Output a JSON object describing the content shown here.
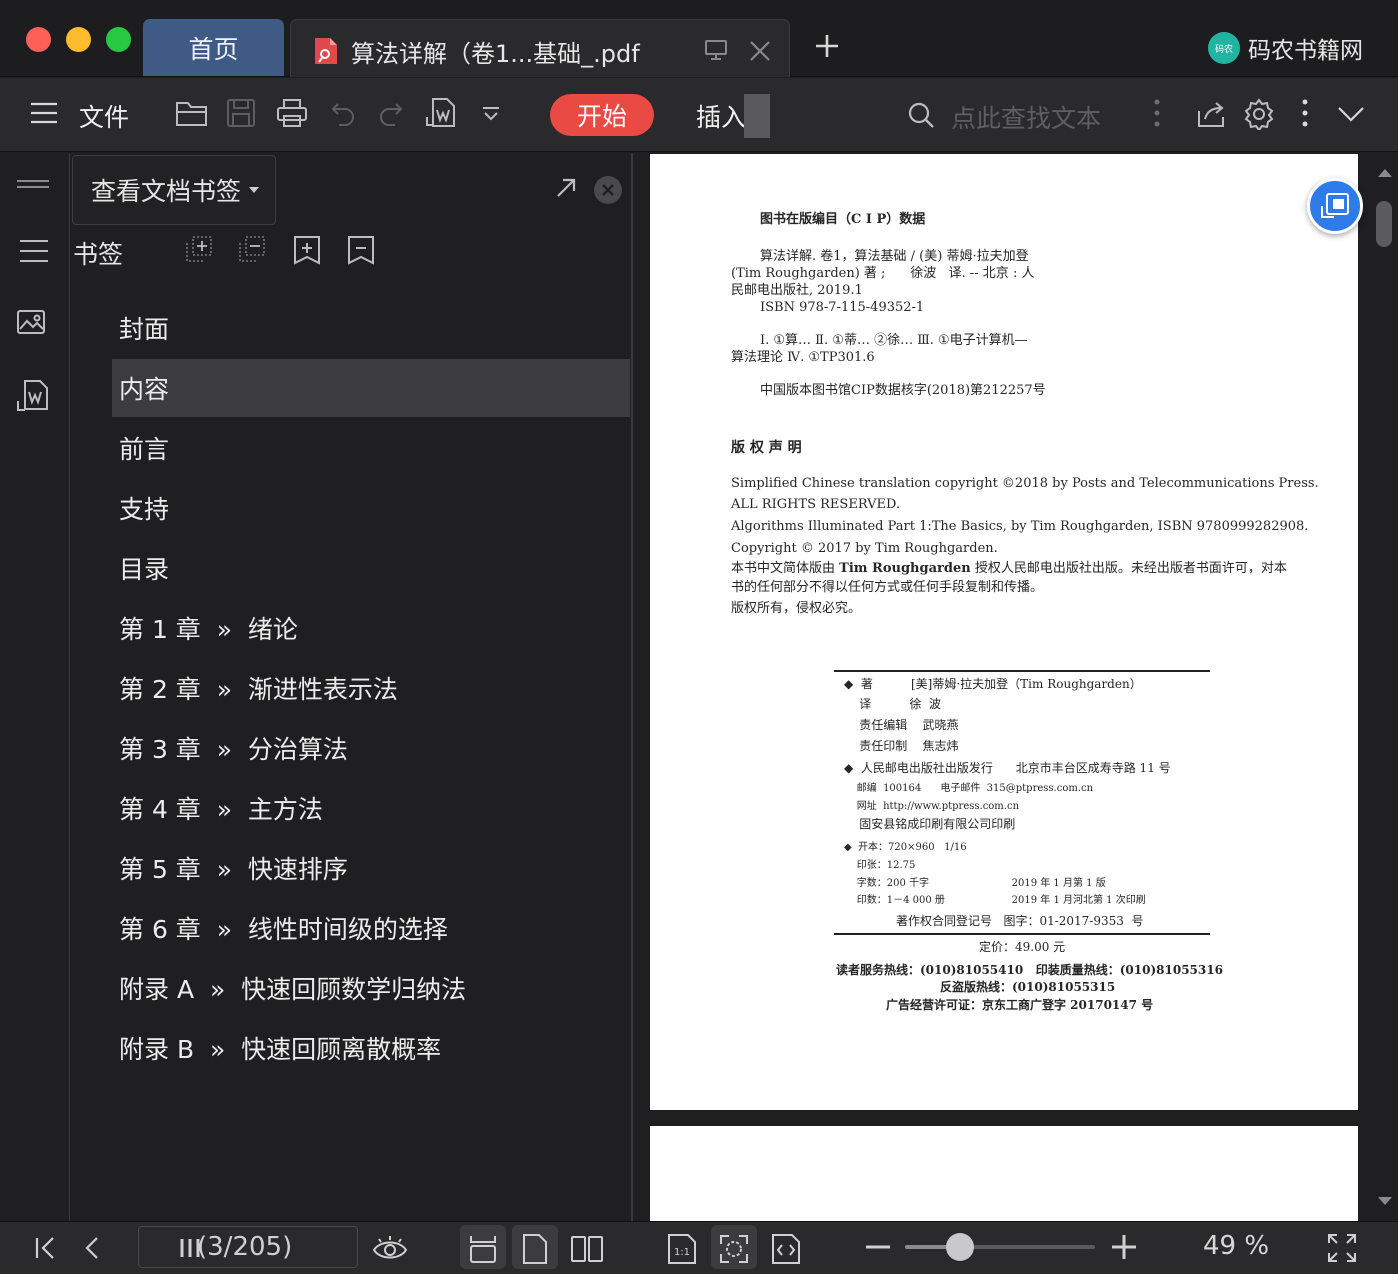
{
  "tabs": {
    "home": "首页",
    "document": "算法详解（卷1...基础_.pdf"
  },
  "brand": {
    "logo_text": "码农",
    "name": "码农书籍网"
  },
  "toolbar": {
    "file_label": "文件",
    "start_label": "开始",
    "insert_label": "插入",
    "search_placeholder": "点此查找文本",
    "accent": "#e94a43"
  },
  "bookmark_panel": {
    "view_select": "查看文档书签",
    "title": "书签",
    "items": [
      {
        "label": "封面",
        "selected": false
      },
      {
        "label": "内容",
        "selected": true
      },
      {
        "label": "前言",
        "selected": false
      },
      {
        "label": "支持",
        "selected": false
      },
      {
        "label": "目录",
        "selected": false
      },
      {
        "label": "第 1 章  »  绪论",
        "selected": false
      },
      {
        "label": "第 2 章  »  渐进性表示法",
        "selected": false
      },
      {
        "label": "第 3 章  »  分治算法",
        "selected": false
      },
      {
        "label": "第 4 章  »  主方法",
        "selected": false
      },
      {
        "label": "第 5 章  »  快速排序",
        "selected": false
      },
      {
        "label": "第 6 章  »  线性时间级的选择",
        "selected": false
      },
      {
        "label": "附录 A  »  快速回顾数学归纳法",
        "selected": false
      },
      {
        "label": "附录 B  »  快速回顾离散概率",
        "selected": false
      }
    ]
  },
  "page": {
    "cip_title": "图书在版编目（C I P）数据",
    "cip_line1": "算法详解. 卷1，算法基础 / (美) 蒂姆·拉夫加登",
    "cip_line2": "(Tim Roughgarden) 著 ;      徐波   译. -- 北京 : 人",
    "cip_line3": "民邮电出版社, 2019.1",
    "cip_line4": "ISBN 978-7-115-49352-1",
    "cip_line5": "Ⅰ. ①算… Ⅱ. ①蒂… ②徐… Ⅲ. ①电子计算机—",
    "cip_line6": "算法理论 Ⅳ. ①TP301.6",
    "cip_line7": "中国版本图书馆CIP数据核字(2018)第212257号",
    "rights_title": "版 权 声 明",
    "rights_line1": "Simplified Chinese translation copyright ©2018 by Posts and Telecommunications Press.",
    "rights_line2": "ALL RIGHTS RESERVED.",
    "rights_line3": "Algorithms Illuminated Part 1:The Basics, by Tim Roughgarden, ISBN 9780999282908.",
    "rights_line4": "Copyright © 2017 by Tim Roughgarden.",
    "rights_line5a": "本书中文简体版由 ",
    "rights_line5b": "Tim Roughgarden",
    "rights_line5c": " 授权人民邮电出版社出版。未经出版者书面许可，对本",
    "rights_line6": "书的任何部分不得以任何方式或任何手段复制和传播。",
    "rights_line7": "版权所有，侵权必究。",
    "credit1": "◆  著          [美]蒂姆·拉夫加登（Tim Roughgarden）",
    "credit2": "    译          徐  波",
    "credit3": "    责任编辑    武晓燕",
    "credit4": "    责任印制    焦志炜",
    "pub1": "◆  人民邮电出版社出版发行      北京市丰台区成寿寺路 11 号",
    "pub2": "    邮编  100164      电子邮件  315@ptpress.com.cn",
    "pub3": "    网址  http://www.ptpress.com.cn",
    "pub4": "    固安县铭成印刷有限公司印刷",
    "spec1": "◆  开本：720×960   1/16",
    "spec2": "    印张：12.75",
    "spec3": "    字数：200 千字                          2019 年 1 月第 1 版",
    "spec4": "    印数：1－4 000 册                     2019 年 1 月河北第 1 次印刷",
    "reg": "著作权合同登记号   图字：01-2017-9353  号",
    "price": "定价：49.00 元",
    "hotline1": "读者服务热线：(010)81055410   印装质量热线：(010)81055316",
    "hotline2": "反盗版热线：(010)81055315",
    "license": "广告经营许可证：京东工商广登字 20170147 号"
  },
  "statusbar": {
    "page_indicator": "(3/205)",
    "zoom": "49 %",
    "zoom_fraction": 0.29
  },
  "colors": {
    "home_tab": "#3e5a85",
    "float_button": "#2f7bea",
    "selected_row": "#3c3c3e"
  }
}
